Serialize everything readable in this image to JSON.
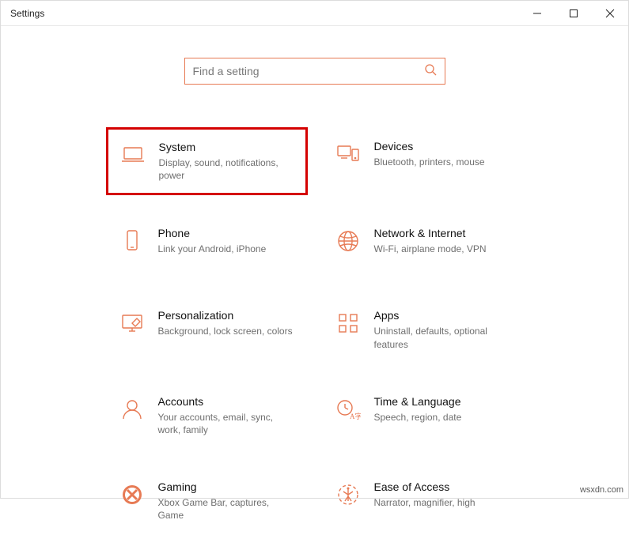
{
  "window": {
    "title": "Settings"
  },
  "search": {
    "placeholder": "Find a setting"
  },
  "categories": [
    {
      "icon": "laptop-icon",
      "title": "System",
      "desc": "Display, sound, notifications, power",
      "highlight": true
    },
    {
      "icon": "devices-icon",
      "title": "Devices",
      "desc": "Bluetooth, printers, mouse"
    },
    {
      "icon": "phone-icon",
      "title": "Phone",
      "desc": "Link your Android, iPhone"
    },
    {
      "icon": "globe-icon",
      "title": "Network & Internet",
      "desc": "Wi-Fi, airplane mode, VPN"
    },
    {
      "icon": "personalize-icon",
      "title": "Personalization",
      "desc": "Background, lock screen, colors"
    },
    {
      "icon": "apps-icon",
      "title": "Apps",
      "desc": "Uninstall, defaults, optional features"
    },
    {
      "icon": "accounts-icon",
      "title": "Accounts",
      "desc": "Your accounts, email, sync, work, family"
    },
    {
      "icon": "time-language-icon",
      "title": "Time & Language",
      "desc": "Speech, region, date"
    },
    {
      "icon": "gaming-icon",
      "title": "Gaming",
      "desc": "Xbox Game Bar, captures, Game"
    },
    {
      "icon": "ease-icon",
      "title": "Ease of Access",
      "desc": "Narrator, magnifier, high"
    }
  ],
  "watermark": "wsxdn.com"
}
